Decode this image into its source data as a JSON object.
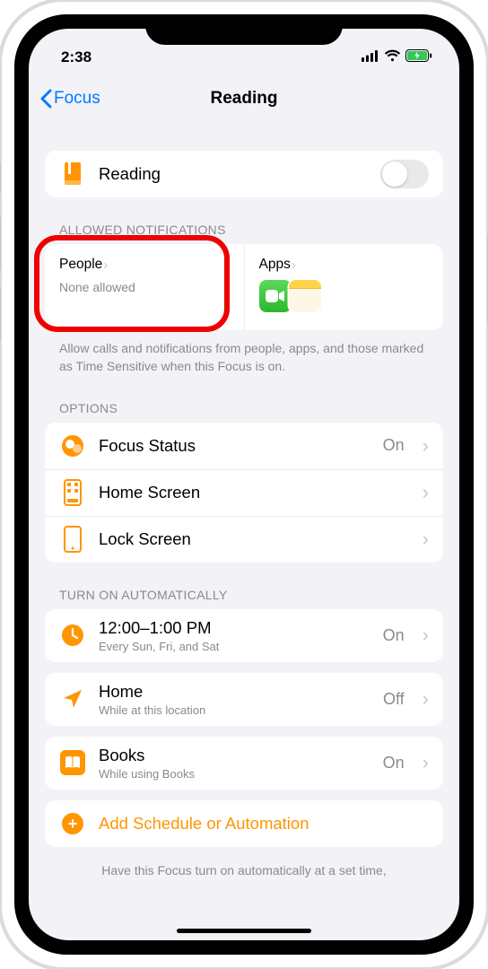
{
  "status": {
    "time": "2:38"
  },
  "nav": {
    "back": "Focus",
    "title": "Reading"
  },
  "focus": {
    "name": "Reading"
  },
  "allowed": {
    "header": "ALLOWED NOTIFICATIONS",
    "people": {
      "title": "People",
      "sub": "None allowed"
    },
    "apps": {
      "title": "Apps"
    },
    "footer": "Allow calls and notifications from people, apps, and those marked as Time Sensitive when this Focus is on."
  },
  "options": {
    "header": "OPTIONS",
    "focus_status": {
      "label": "Focus Status",
      "value": "On"
    },
    "home_screen": {
      "label": "Home Screen"
    },
    "lock_screen": {
      "label": "Lock Screen"
    }
  },
  "auto": {
    "header": "TURN ON AUTOMATICALLY",
    "schedule": {
      "title": "12:00–1:00 PM",
      "sub": "Every Sun, Fri, and Sat",
      "value": "On"
    },
    "location": {
      "title": "Home",
      "sub": "While at this location",
      "value": "Off"
    },
    "app": {
      "title": "Books",
      "sub": "While using Books",
      "value": "On"
    },
    "add": "Add Schedule or Automation",
    "footer": "Have this Focus turn on automatically at a set time,"
  }
}
